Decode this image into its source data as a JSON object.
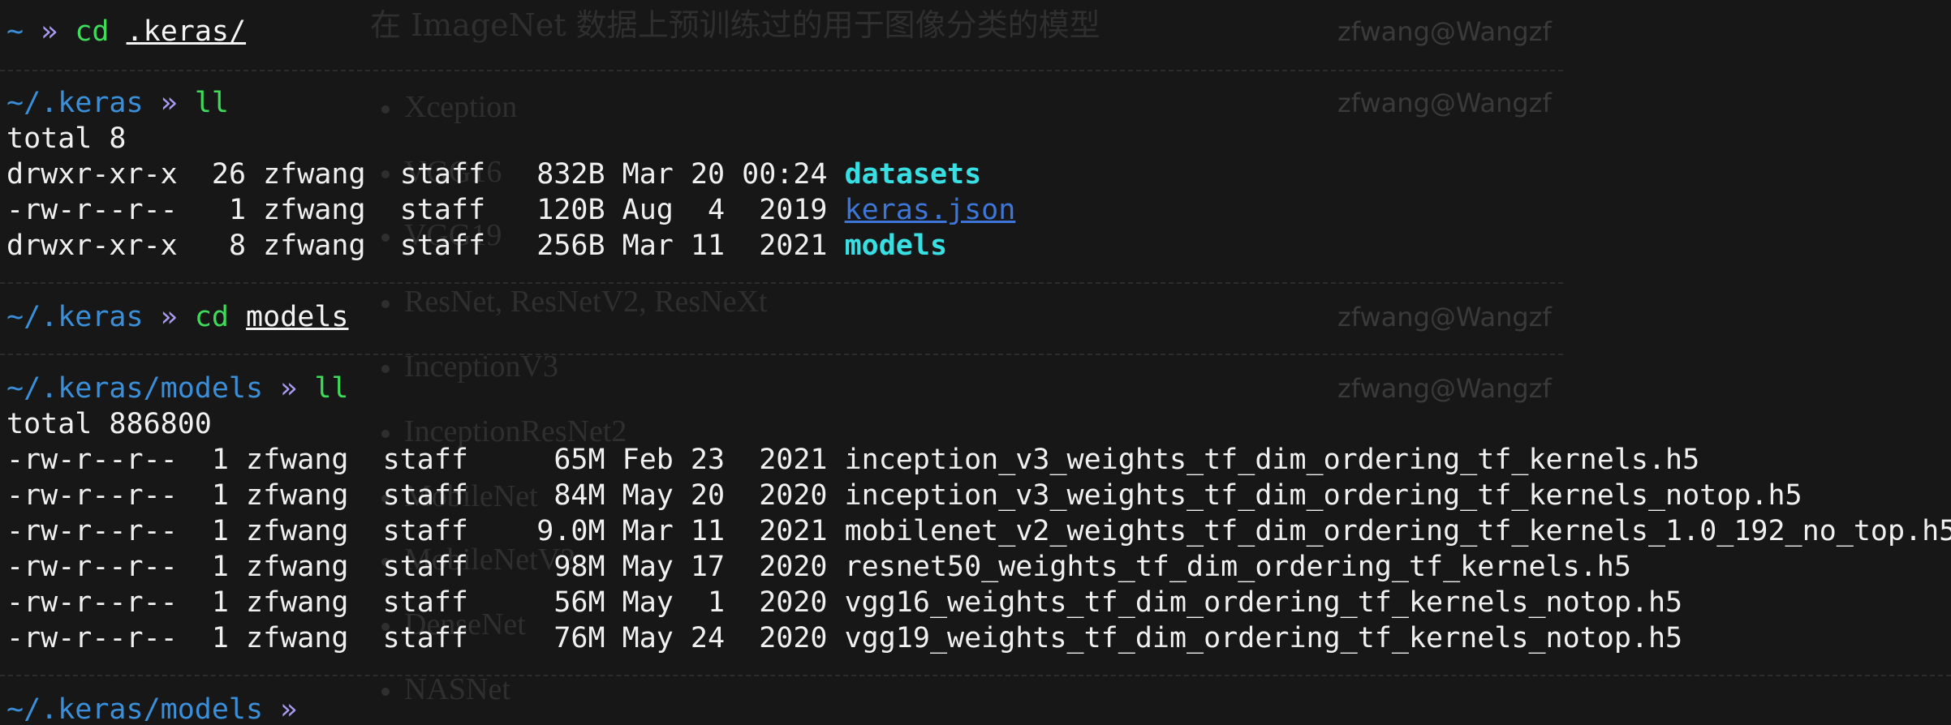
{
  "overlay": {
    "title": "在 ImageNet 数据上预训练过的用于图像分类的模型",
    "items": [
      "Xception",
      "VGG16",
      "VGG19",
      "ResNet, ResNetV2, ResNeXt",
      "InceptionV3",
      "InceptionResNet2",
      "MobileNet",
      "MobileNetV2",
      "DenseNet",
      "NASNet"
    ],
    "users": [
      "zfwang@Wangzf",
      "zfwang@Wangzf",
      "zfwang@Wangzf",
      "zfwang@Wangzf"
    ]
  },
  "terminal": {
    "cmd1": {
      "path": "~",
      "sep": "»",
      "cmd": "cd",
      "arg": ".keras/"
    },
    "cmd2": {
      "path": "~/.keras",
      "sep": "»",
      "cmd": "ll"
    },
    "out2_total": "total 8",
    "listing1": [
      {
        "perm": "drwxr-xr-x",
        "links": "26",
        "owner": "zfwang",
        "group": "staff",
        "size": "832B",
        "date": "Mar 20 00:24",
        "name": "datasets",
        "kind": "dir"
      },
      {
        "perm": "-rw-r--r--",
        "links": "1",
        "owner": "zfwang",
        "group": "staff",
        "size": "120B",
        "date": "Aug  4  2019",
        "name": "keras.json",
        "kind": "link"
      },
      {
        "perm": "drwxr-xr-x",
        "links": "8",
        "owner": "zfwang",
        "group": "staff",
        "size": "256B",
        "date": "Mar 11  2021",
        "name": "models",
        "kind": "dir"
      }
    ],
    "cmd3": {
      "path": "~/.keras",
      "sep": "»",
      "cmd": "cd",
      "arg": "models"
    },
    "cmd4": {
      "path": "~/.keras/models",
      "sep": "»",
      "cmd": "ll"
    },
    "out4_total": "total 886800",
    "listing2": [
      {
        "perm": "-rw-r--r--",
        "links": "1",
        "owner": "zfwang",
        "group": "staff",
        "size": "65M",
        "date": "Feb 23  2021",
        "name": "inception_v3_weights_tf_dim_ordering_tf_kernels.h5"
      },
      {
        "perm": "-rw-r--r--",
        "links": "1",
        "owner": "zfwang",
        "group": "staff",
        "size": "84M",
        "date": "May 20  2020",
        "name": "inception_v3_weights_tf_dim_ordering_tf_kernels_notop.h5"
      },
      {
        "perm": "-rw-r--r--",
        "links": "1",
        "owner": "zfwang",
        "group": "staff",
        "size": "9.0M",
        "date": "Mar 11  2021",
        "name": "mobilenet_v2_weights_tf_dim_ordering_tf_kernels_1.0_192_no_top.h5"
      },
      {
        "perm": "-rw-r--r--",
        "links": "1",
        "owner": "zfwang",
        "group": "staff",
        "size": "98M",
        "date": "May 17  2020",
        "name": "resnet50_weights_tf_dim_ordering_tf_kernels.h5"
      },
      {
        "perm": "-rw-r--r--",
        "links": "1",
        "owner": "zfwang",
        "group": "staff",
        "size": "56M",
        "date": "May  1  2020",
        "name": "vgg16_weights_tf_dim_ordering_tf_kernels_notop.h5"
      },
      {
        "perm": "-rw-r--r--",
        "links": "1",
        "owner": "zfwang",
        "group": "staff",
        "size": "76M",
        "date": "May 24  2020",
        "name": "vgg19_weights_tf_dim_ordering_tf_kernels_notop.h5"
      }
    ],
    "cmd5": {
      "path": "~/.keras/models",
      "sep": "»"
    }
  },
  "colors": {
    "background": "#171717",
    "path": "#3b8fd9",
    "separator": "#a89bf0",
    "command": "#3ddc5a",
    "directory": "#39e0e3",
    "link": "#3d76d8"
  }
}
